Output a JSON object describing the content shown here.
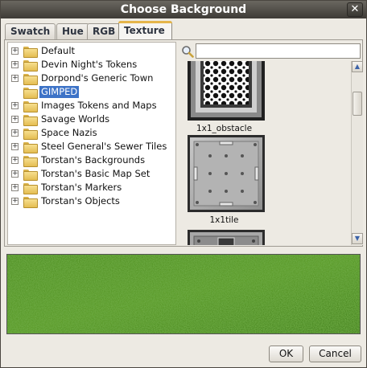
{
  "window": {
    "title": "Choose Background",
    "close_glyph": "✕"
  },
  "tabs": [
    {
      "label": "Swatch"
    },
    {
      "label": "Hue"
    },
    {
      "label": "RGB"
    },
    {
      "label": "Texture"
    }
  ],
  "active_tab": "Texture",
  "tree": {
    "items": [
      {
        "label": "Default",
        "expander": "+"
      },
      {
        "label": "Devin Night's Tokens",
        "expander": "+"
      },
      {
        "label": "Dorpond's Generic Town",
        "expander": "+"
      },
      {
        "label": "GIMPED",
        "expander": ""
      },
      {
        "label": "Images Tokens and Maps",
        "expander": "+"
      },
      {
        "label": "Savage Worlds",
        "expander": "+"
      },
      {
        "label": "Space Nazis",
        "expander": "+"
      },
      {
        "label": "Steel General's Sewer Tiles",
        "expander": "+"
      },
      {
        "label": "Torstan's Backgrounds",
        "expander": "+"
      },
      {
        "label": "Torstan's Basic Map Set",
        "expander": "+"
      },
      {
        "label": "Torstan's Markers",
        "expander": "+"
      },
      {
        "label": "Torstan's Objects",
        "expander": "+"
      }
    ],
    "selected": "GIMPED"
  },
  "search": {
    "value": "",
    "placeholder": "",
    "icon": "magnifier-icon"
  },
  "gallery": {
    "items": [
      {
        "label": "1x1_obstacle"
      },
      {
        "label": "1x1tile"
      },
      {
        "label": ""
      }
    ]
  },
  "scrollbar": {
    "up_glyph": "▲",
    "down_glyph": "▼"
  },
  "preview": {
    "texture": "grass"
  },
  "buttons": {
    "ok": "OK",
    "cancel": "Cancel"
  },
  "colors": {
    "selection": "#3d73c7",
    "active_tab_accent": "#e5b54a",
    "grass": "#4a8a1e"
  }
}
